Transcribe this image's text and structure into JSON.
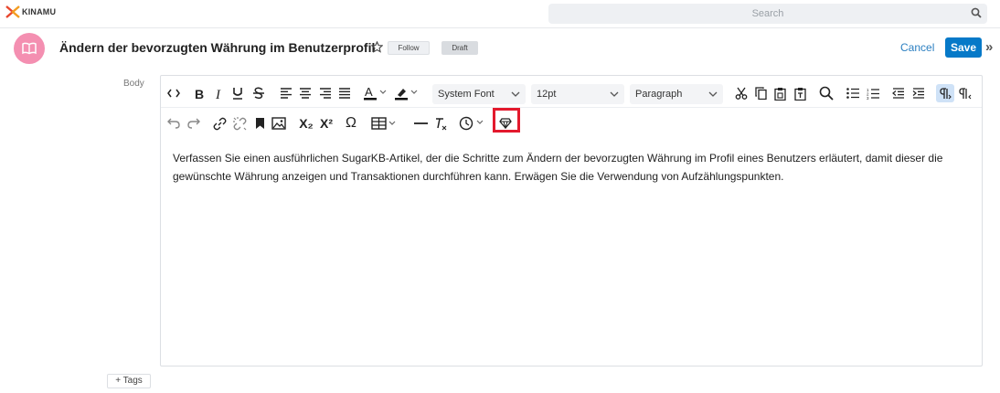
{
  "app": {
    "logo_text": "KINAMU"
  },
  "search": {
    "placeholder": "Search"
  },
  "header": {
    "title": "Ändern der bevorzugten Währung im Benutzerprofil",
    "follow_label": "Follow",
    "status_label": "Draft",
    "cancel_label": "Cancel",
    "save_label": "Save",
    "expand_glyph": "»"
  },
  "fields": {
    "body_label": "Body",
    "tags_label": "+ Tags"
  },
  "toolbar": {
    "font_family": "System Font",
    "font_size": "12pt",
    "block_format": "Paragraph",
    "subscript": "X₂",
    "superscript": "X²",
    "omega": "Ω",
    "clear_format": "Tx"
  },
  "editor": {
    "content": "Verfassen Sie einen ausführlichen SugarKB-Artikel, der die Schritte zum Ändern der bevorzugten Währung im Profil eines Benutzers erläutert, damit dieser die gewünschte Währung anzeigen und Transaktionen durchführen kann. Erwägen Sie die Verwendung von Aufzählungspunkten."
  },
  "colors": {
    "accent": "#0679c8",
    "link": "#2b7fc1",
    "avatar": "#f48fb1",
    "highlight": "#e3192d"
  },
  "icons": [
    "search-icon",
    "book-icon",
    "star-icon",
    "code-icon",
    "bold-icon",
    "italic-icon",
    "underline-icon",
    "strikethrough-icon",
    "align-left-icon",
    "align-center-icon",
    "align-right-icon",
    "align-justify-icon",
    "text-color-icon",
    "highlight-color-icon",
    "cut-icon",
    "copy-icon",
    "paste-icon",
    "paste-text-icon",
    "find-icon",
    "bullet-list-icon",
    "numbered-list-icon",
    "outdent-icon",
    "indent-icon",
    "ltr-icon",
    "rtl-icon",
    "undo-icon",
    "redo-icon",
    "link-icon",
    "unlink-icon",
    "bookmark-icon",
    "image-icon",
    "table-icon",
    "horizontal-rule-icon",
    "clock-icon",
    "gem-icon"
  ]
}
